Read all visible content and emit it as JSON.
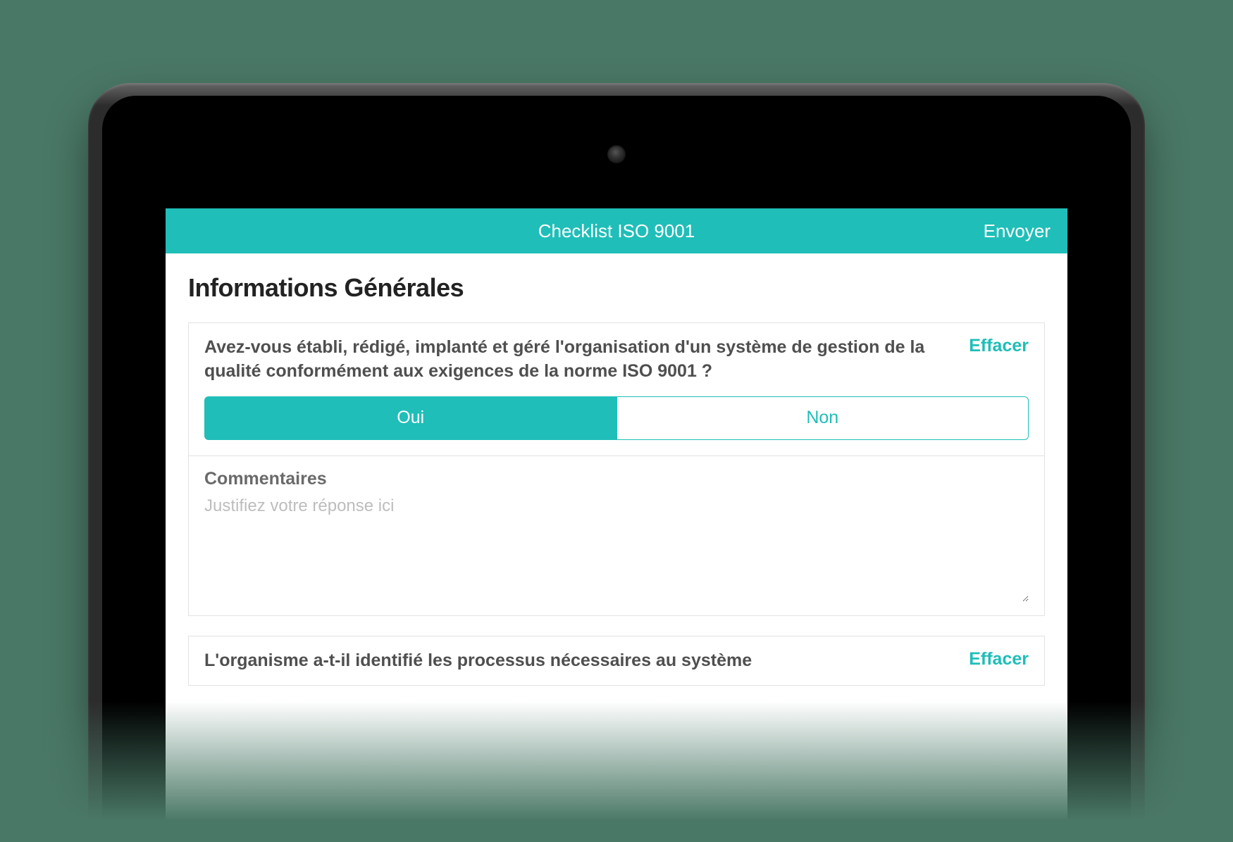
{
  "colors": {
    "accent": "#1fbeb8",
    "background": "#4a7866"
  },
  "header": {
    "title": "Checklist ISO 9001",
    "send": "Envoyer"
  },
  "section": {
    "title": "Informations Générales"
  },
  "questions": [
    {
      "text": "Avez-vous établi, rédigé, implanté et géré l'organisation d'un système de gestion de la qualité conformément aux exigences de la norme ISO 9001 ?",
      "clear": "Effacer",
      "yes": "Oui",
      "no": "Non",
      "selected": "yes",
      "comments_label": "Commentaires",
      "comments_placeholder": "Justifiez votre réponse ici",
      "comments_value": ""
    },
    {
      "text": "L'organisme a-t-il identifié les processus nécessaires au système",
      "clear": "Effacer"
    }
  ]
}
